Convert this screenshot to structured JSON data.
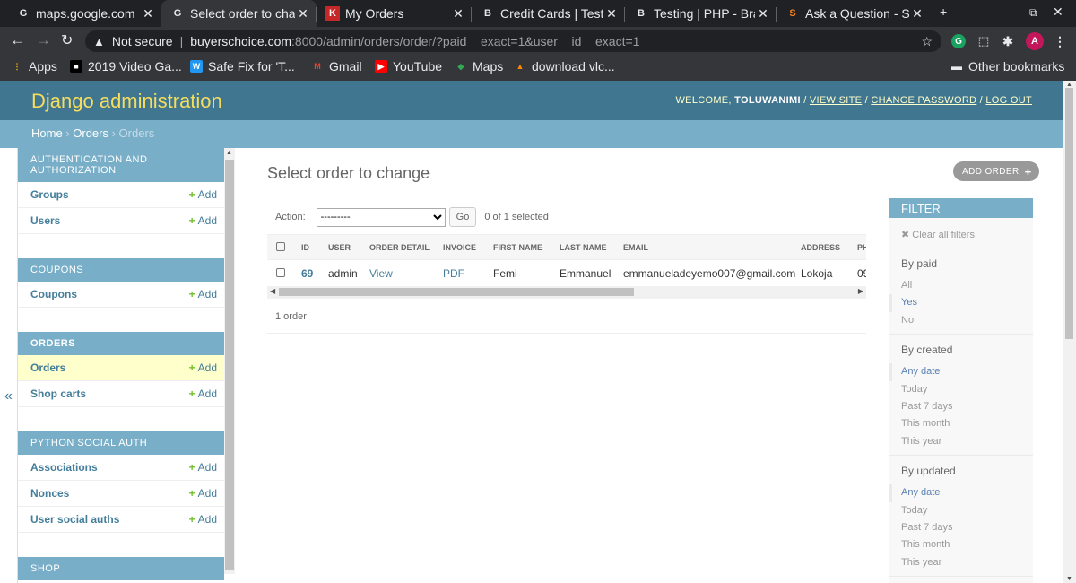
{
  "browser": {
    "tabs": [
      {
        "title": "maps.google.com",
        "icon": "G",
        "icon_color": "#e8eaed",
        "icon_bg": "transparent"
      },
      {
        "title": "Select order to chan",
        "icon": "G",
        "icon_color": "#e8eaed",
        "icon_bg": "transparent"
      },
      {
        "title": "My Orders",
        "icon": "K",
        "icon_color": "#fff",
        "icon_bg": "#c62828"
      },
      {
        "title": "Credit Cards | Testi",
        "icon": "B",
        "icon_color": "#e8eaed",
        "icon_bg": "transparent"
      },
      {
        "title": "Testing | PHP - Brai",
        "icon": "B",
        "icon_color": "#e8eaed",
        "icon_bg": "transparent"
      },
      {
        "title": "Ask a Question - St",
        "icon": "S",
        "icon_color": "#f48024",
        "icon_bg": "transparent"
      }
    ],
    "new_tab": "+",
    "url_security": "Not secure",
    "url_host": "buyerschoice.com",
    "url_path": ":8000/admin/orders/order/?paid__exact=1&user__id__exact=1",
    "profile_initial": "A",
    "ext_initial": "G",
    "bookmarks": [
      {
        "label": "Apps",
        "icon": "⋮",
        "color": "#f4b400",
        "bg": "transparent"
      },
      {
        "label": "2019 Video Ga...",
        "icon": "■",
        "color": "#fff",
        "bg": "#000"
      },
      {
        "label": "Safe Fix for 'T...",
        "icon": "W",
        "color": "#fff",
        "bg": "#2196f3"
      },
      {
        "label": "Gmail",
        "icon": "M",
        "color": "#ea4335",
        "bg": "transparent"
      },
      {
        "label": "YouTube",
        "icon": "▶",
        "color": "#fff",
        "bg": "#ff0000"
      },
      {
        "label": "Maps",
        "icon": "◆",
        "color": "#34a853",
        "bg": "transparent"
      },
      {
        "label": "download vlc...",
        "icon": "▲",
        "color": "#ff8800",
        "bg": "transparent"
      }
    ],
    "other_bookmarks": "Other bookmarks"
  },
  "admin": {
    "brand": "Django administration",
    "welcome": "WELCOME,",
    "username": "TOLUWANIMI",
    "view_site": "VIEW SITE",
    "change_password": "CHANGE PASSWORD",
    "log_out": "LOG OUT",
    "crumbs": {
      "home": "Home",
      "app": "Orders",
      "current": "Orders"
    }
  },
  "sidebar": {
    "add_label": "Add",
    "modules": [
      {
        "caption": "Authentication and Authorization",
        "current": false,
        "rows": [
          {
            "label": "Groups",
            "current": false
          },
          {
            "label": "Users",
            "current": false
          }
        ]
      },
      {
        "caption": "Coupons",
        "current": false,
        "rows": [
          {
            "label": "Coupons",
            "current": false
          }
        ]
      },
      {
        "caption": "Orders",
        "current": true,
        "rows": [
          {
            "label": "Orders",
            "current": true
          },
          {
            "label": "Shop carts",
            "current": false
          }
        ]
      },
      {
        "caption": "Python Social Auth",
        "current": false,
        "rows": [
          {
            "label": "Associations",
            "current": false
          },
          {
            "label": "Nonces",
            "current": false
          },
          {
            "label": "User social auths",
            "current": false
          }
        ]
      },
      {
        "caption": "Shop",
        "current": false,
        "rows": []
      }
    ],
    "collapse_glyph": "«"
  },
  "main": {
    "title": "Select order to change",
    "add_button": "ADD ORDER",
    "action_label": "Action:",
    "action_value": "---------",
    "go_label": "Go",
    "selected_count": "0 of 1 selected",
    "columns": [
      "ID",
      "USER",
      "ORDER DETAIL",
      "INVOICE",
      "FIRST NAME",
      "LAST NAME",
      "EMAIL",
      "ADDRESS",
      "PH"
    ],
    "rows": [
      {
        "id": "69",
        "user": "admin",
        "order_detail": "View",
        "invoice": "PDF",
        "first_name": "Femi",
        "last_name": "Emmanuel",
        "email": "emmanueladeyemo007@gmail.com",
        "address": "Lokoja",
        "phone": "09"
      }
    ],
    "paginator": "1 order"
  },
  "filter": {
    "title": "FILTER",
    "clear": "Clear all filters",
    "sections": [
      {
        "title": "By paid",
        "options": [
          "All",
          "Yes",
          "No"
        ],
        "selected": 1
      },
      {
        "title": "By created",
        "options": [
          "Any date",
          "Today",
          "Past 7 days",
          "This month",
          "This year"
        ],
        "selected": 0
      },
      {
        "title": "By updated",
        "options": [
          "Any date",
          "Today",
          "Past 7 days",
          "This month",
          "This year"
        ],
        "selected": 0
      }
    ]
  }
}
